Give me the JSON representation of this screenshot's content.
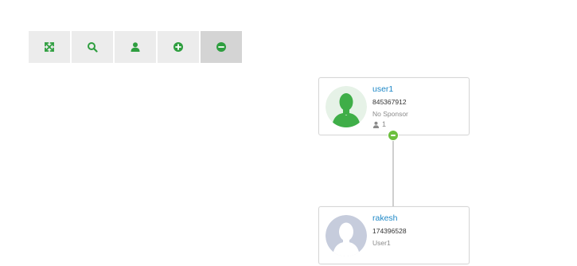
{
  "toolbar": {
    "buttons": [
      {
        "icon": "expand-icon",
        "active": false
      },
      {
        "icon": "search-icon",
        "active": false
      },
      {
        "icon": "user-icon",
        "active": false
      },
      {
        "icon": "zoom-in-icon",
        "active": false
      },
      {
        "icon": "zoom-out-icon",
        "active": true
      }
    ],
    "accent_color": "#2e9e3f"
  },
  "tree": {
    "root": {
      "name": "user1",
      "id_number": "845367912",
      "sponsor": "No Sponsor",
      "downline_count": "1",
      "avatar": "green-silhouette-avatar"
    },
    "child": {
      "name": "rakesh",
      "id_number": "174396528",
      "sponsor": "User1",
      "avatar": "gray-silhouette-avatar"
    },
    "toggle_color": "#6cbf3e"
  }
}
